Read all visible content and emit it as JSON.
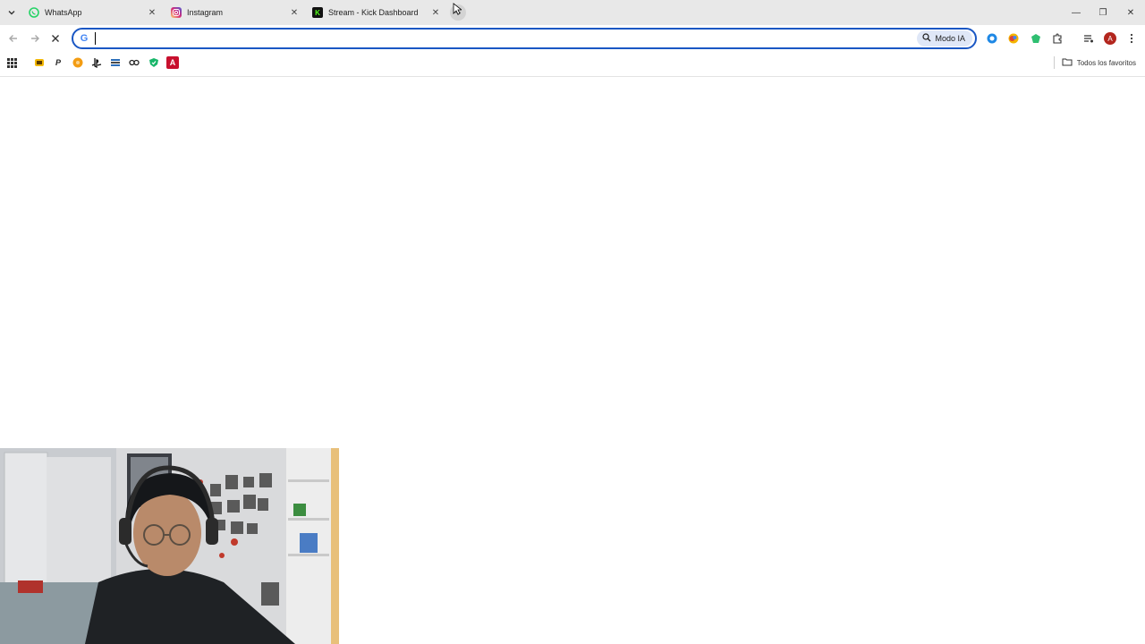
{
  "tabs": [
    {
      "title": "WhatsApp",
      "icon": "whatsapp-icon",
      "color": "#25d366"
    },
    {
      "title": "Instagram",
      "icon": "instagram-icon",
      "color": "#d6249f"
    },
    {
      "title": "Stream - Kick Dashboard",
      "icon": "kick-icon",
      "color": "#53fc18"
    }
  ],
  "toolbar": {
    "omnibox_value": "",
    "modo_ia_label": "Modo IA",
    "avatar_initial": "A"
  },
  "bookmarks": {
    "folder_label": "Todos los favoritos",
    "items": [
      "apps-icon",
      "bookmark-yellow-icon",
      "paypal-icon",
      "orange-circle-icon",
      "playstation-icon",
      "bookmark-stack-icon",
      "infinity-icon",
      "shield-green-icon",
      "red-a-icon"
    ]
  },
  "colors": {
    "accent": "#1a57c4",
    "tabstrip_bg": "#e8e8e8",
    "avatar_bg": "#b3261e"
  }
}
